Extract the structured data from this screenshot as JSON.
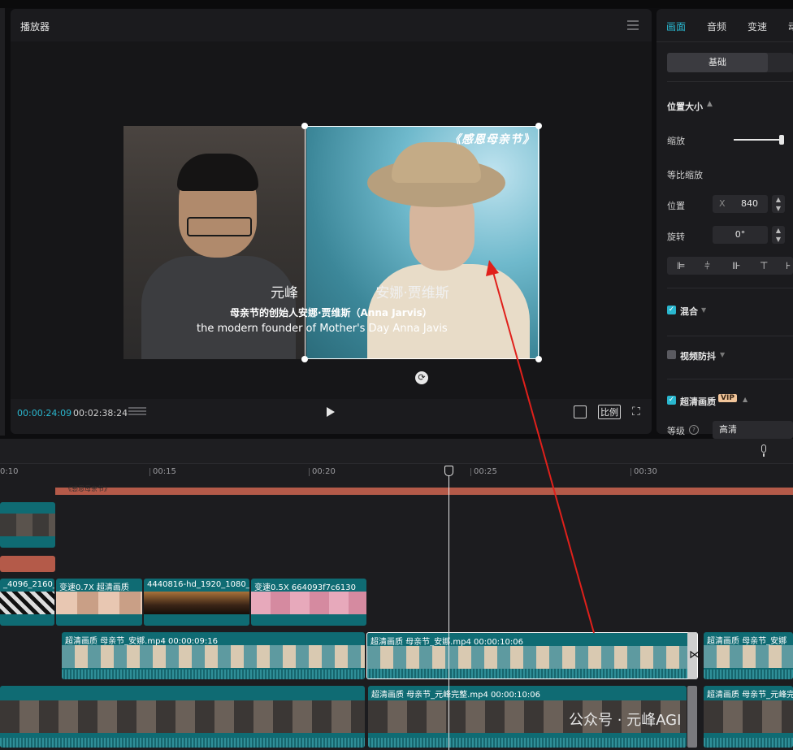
{
  "player": {
    "title": "播放器",
    "overlay_title": "《感恩母亲节》",
    "name_left": "元峰",
    "name_right": "安娜·贾维斯",
    "subtitle_cn": "母亲节的创始人安娜·贾维斯（Anna Jarvis）",
    "subtitle_en": "the modern founder of Mother's Day Anna Javis",
    "time_current": "00:00:24:09",
    "time_total": "00:02:38:24",
    "ratio_label": "比例"
  },
  "inspector": {
    "tabs": [
      "画面",
      "音频",
      "变速",
      "动"
    ],
    "active_tab": "画面",
    "subtab": "基础",
    "section_position_size": "位置大小",
    "scale_label": "缩放",
    "scale_value_fraction": 0.96,
    "uniform_scale_label": "等比缩放",
    "position_label": "位置",
    "position_axis": "X",
    "position_x": "840",
    "rotation_label": "旋转",
    "rotation_value": "0°",
    "blend_label": "混合",
    "stabilize_label": "视频防抖",
    "hd_label": "超清画质",
    "vip_badge": "VIP",
    "level_label": "等级",
    "level_value": "高清"
  },
  "timeline": {
    "ruler": [
      "0:10",
      "00:15",
      "00:20",
      "00:25",
      "00:30"
    ],
    "text_clip_label": "《感恩母亲节》",
    "broll_clips": [
      {
        "label": "_4096_2160_2"
      },
      {
        "label": "变速0.7X  超清画质"
      },
      {
        "label": "4440816-hd_1920_1080_2"
      },
      {
        "label": "变速0.5X  664093f7c6130"
      }
    ],
    "main_clips": [
      {
        "label": "超清画质  母亲节_安娜.mp4  00:00:09:16"
      },
      {
        "label": "超清画质  母亲节_安娜.mp4  00:00:10:06"
      },
      {
        "label": "超清画质  母亲节_安娜"
      }
    ],
    "bottom_clips": [
      {
        "label": "超清画质  母亲节_元峰完整.mp4  00:00:10:06"
      },
      {
        "label": "超清画质  母亲节_元峰完"
      }
    ]
  },
  "watermark": "公众号 · 元峰AGI",
  "colors": {
    "accent": "#2ab7cf",
    "clip_teal": "#0f6b73",
    "text_track": "#b45a49",
    "arrow": "#e0201b"
  }
}
